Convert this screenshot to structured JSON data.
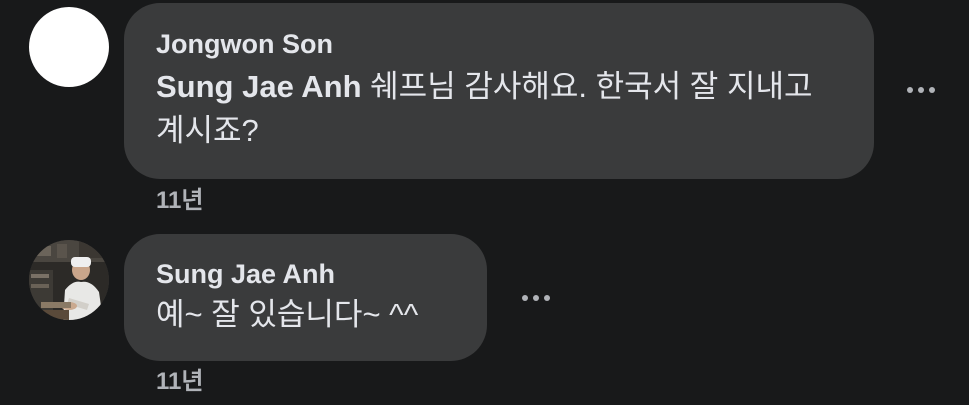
{
  "comments": [
    {
      "author": "Jongwon Son",
      "mention": "Sung Jae Anh",
      "text": " 쉐프님 감사해요. 한국서 잘 지내고 계시죠?",
      "timestamp": "11년",
      "avatar": "white-blank-avatar"
    },
    {
      "author": "Sung Jae Anh",
      "text": "예~ 잘 있습니다~ ^^",
      "timestamp": "11년",
      "avatar": "chef-in-kitchen-photo"
    }
  ],
  "colors": {
    "background": "#18191a",
    "bubble": "#3a3b3c",
    "text": "#e4e6eb",
    "secondary_text": "#b0b3b8"
  }
}
